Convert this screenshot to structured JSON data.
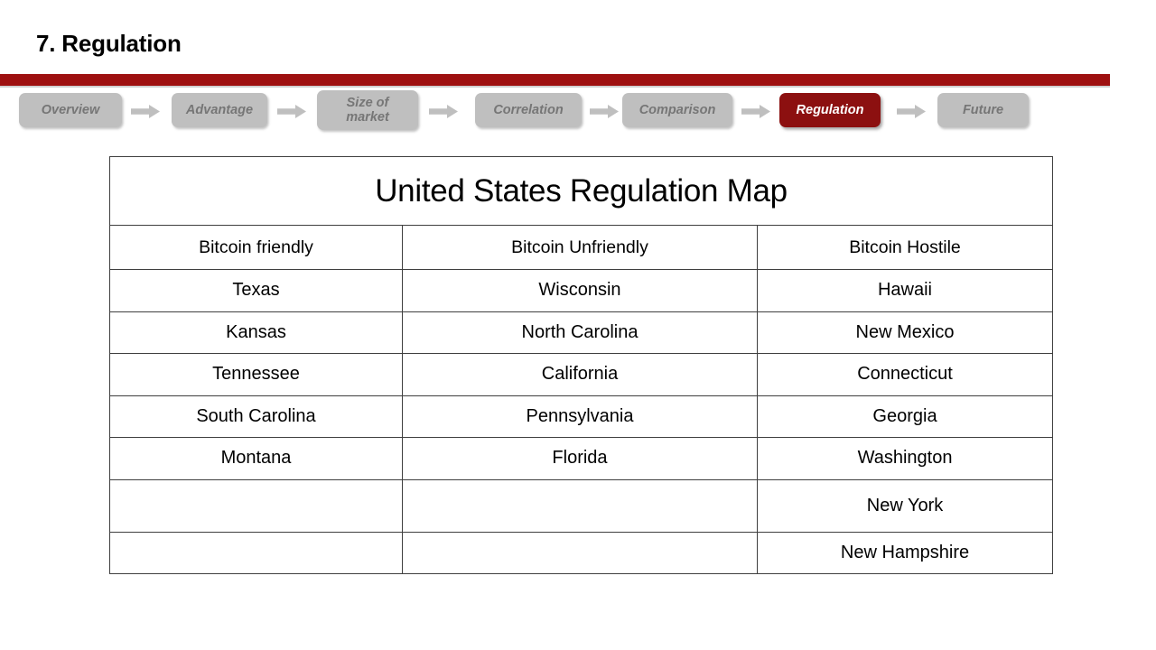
{
  "slide": {
    "title": "7. Regulation",
    "accent_color": "#9E1010",
    "chip_color": "#BFBFBF",
    "chip_text_color": "#767676",
    "active_chip_color": "#8C1010",
    "active_chip_text_color": "#FFFFFF"
  },
  "nav": {
    "items": [
      {
        "label": "Overview",
        "active": false
      },
      {
        "label": "Advantage",
        "active": false
      },
      {
        "label": "Size of\nmarket",
        "line1": "Size of",
        "line2": "market",
        "active": false
      },
      {
        "label": "Correlation",
        "active": false
      },
      {
        "label": "Comparison",
        "active": false
      },
      {
        "label": "Regulation",
        "active": true
      },
      {
        "label": "Future",
        "active": false
      }
    ],
    "arrow_icon": "right-arrow-icon"
  },
  "table": {
    "title": "United States Regulation Map",
    "headers": [
      "Bitcoin friendly",
      "Bitcoin Unfriendly",
      "Bitcoin Hostile"
    ],
    "rows": [
      [
        "Texas",
        "Wisconsin",
        "Hawaii"
      ],
      [
        "Kansas",
        "North Carolina",
        "New Mexico"
      ],
      [
        "Tennessee",
        "California",
        "Connecticut"
      ],
      [
        "South Carolina",
        "Pennsylvania",
        "Georgia"
      ],
      [
        "Montana",
        "Florida",
        "Washington"
      ],
      [
        "",
        "",
        "New York"
      ],
      [
        "",
        "",
        "New Hampshire"
      ]
    ]
  }
}
